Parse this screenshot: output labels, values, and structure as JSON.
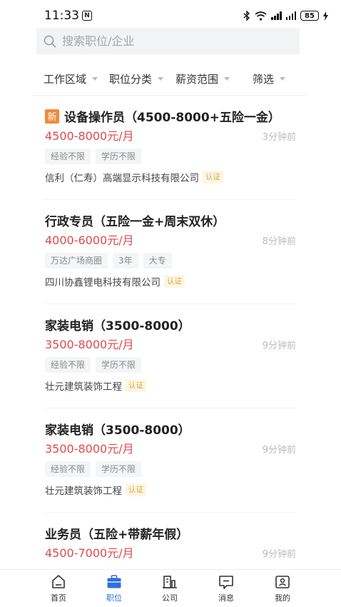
{
  "status_bar": {
    "time": "11:33",
    "n_label": "N",
    "battery": "85"
  },
  "search": {
    "placeholder": "搜索职位/企业"
  },
  "filters": [
    {
      "label": "工作区域"
    },
    {
      "label": "职位分类"
    },
    {
      "label": "薪资范围"
    },
    {
      "label": "筛选"
    }
  ],
  "jobs": [
    {
      "badge": "新",
      "title": "设备操作员（4500-8000+五险一金）",
      "salary": "4500-8000元/月",
      "time": "3分钟前",
      "tags": [
        "经验不限",
        "学历不限"
      ],
      "company": "信利（仁寿）高端显示科技有限公司",
      "cert": "认证"
    },
    {
      "title": "行政专员（五险一金+周末双休）",
      "salary": "4000-6000元/月",
      "time": "8分钟前",
      "tags": [
        "万达广场商圈",
        "3年",
        "大专"
      ],
      "company": "四川协鑫锂电科技有限公司",
      "cert": "认证"
    },
    {
      "title": "家装电销（3500-8000）",
      "salary": "3500-8000元/月",
      "time": "9分钟前",
      "tags": [
        "经验不限",
        "学历不限"
      ],
      "company": "壮元建筑装饰工程",
      "cert": "认证"
    },
    {
      "title": "家装电销（3500-8000）",
      "salary": "3500-8000元/月",
      "time": "9分钟前",
      "tags": [
        "经验不限",
        "学历不限"
      ],
      "company": "壮元建筑装饰工程",
      "cert": "认证"
    },
    {
      "title": "业务员（五险+带薪年假）",
      "salary": "4500-7000元/月",
      "time": "9分钟前",
      "tags": [],
      "company": "",
      "cert": ""
    }
  ],
  "bottom_nav": [
    {
      "label": "首页",
      "icon": "home-icon"
    },
    {
      "label": "职位",
      "icon": "briefcase-icon",
      "active": true
    },
    {
      "label": "公司",
      "icon": "building-icon"
    },
    {
      "label": "消息",
      "icon": "message-icon"
    },
    {
      "label": "我的",
      "icon": "profile-icon"
    }
  ],
  "colors": {
    "accent": "#2f6fe0",
    "salary": "#e04a4a",
    "new_badge": "#f08c3a",
    "cert_text": "#d9a440"
  }
}
